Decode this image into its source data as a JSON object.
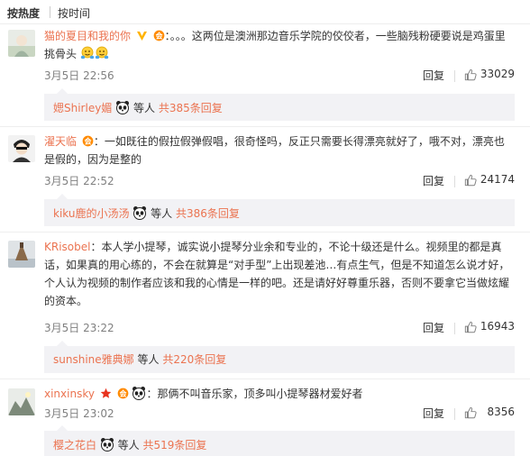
{
  "sort": {
    "hot": "按热度",
    "time": "按时间"
  },
  "comments": [
    {
      "user": "猫的夏目和我的你",
      "colon": "：",
      "text": "。。。这两位是澳洲那边音乐学院的佼佼者，一些脑残粉硬要说是鸡蛋里挑骨头",
      "time": "3月5日 22:56",
      "reply_label": "回复",
      "likes": "33029",
      "replies_user": "媤Shirley媚",
      "replies_etc": "等人",
      "replies_total": "共385条回复"
    },
    {
      "user": "濯天临",
      "colon": "：",
      "text": "一如既往的假拉假弹假唱，很奇怪吗，反正只需要长得漂亮就好了，哦不对，漂亮也是假的，因为是整的",
      "time": "3月5日 22:52",
      "reply_label": "回复",
      "likes": "24174",
      "replies_user": "kiku鹿的小汤汤",
      "replies_etc": "等人",
      "replies_total": "共386条回复"
    },
    {
      "user": "KRisobel",
      "colon": "：",
      "text": "本人学小提琴，诚实说小提琴分业余和专业的，不论十级还是什么。视频里的都是真话，如果真的用心练的，不会在就算是“对手型”上出现差池…有点生气，但是不知道怎么说才好，个人认为视频的制作者应该和我的心情是一样的吧。还是请好好尊重乐器，否则不要拿它当做炫耀的资本。",
      "time": "3月5日 23:22",
      "reply_label": "回复",
      "likes": "16943",
      "replies_user": "sunshine雅典娜",
      "replies_etc": "等人",
      "replies_total": "共220条回复"
    },
    {
      "user": "xinxinsky",
      "colon": "：",
      "text": "那俩不叫音乐家，顶多叫小提琴器材爱好者",
      "time": "3月5日 23:02",
      "reply_label": "回复",
      "likes": "8356",
      "replies_user": "樱之花白",
      "replies_etc": "等人",
      "replies_total": "共519条回复"
    }
  ],
  "icons": {
    "like": "thumbs-up-icon",
    "vip": "vip-v-icon",
    "member": "member-badge-icon",
    "star": "star-icon",
    "panda": "panda-emoji-icon",
    "hug": "hug-emoji-icon"
  },
  "colors": {
    "link": "#eb7350",
    "muted": "#808080",
    "reply_bg": "#f2f2f5"
  }
}
